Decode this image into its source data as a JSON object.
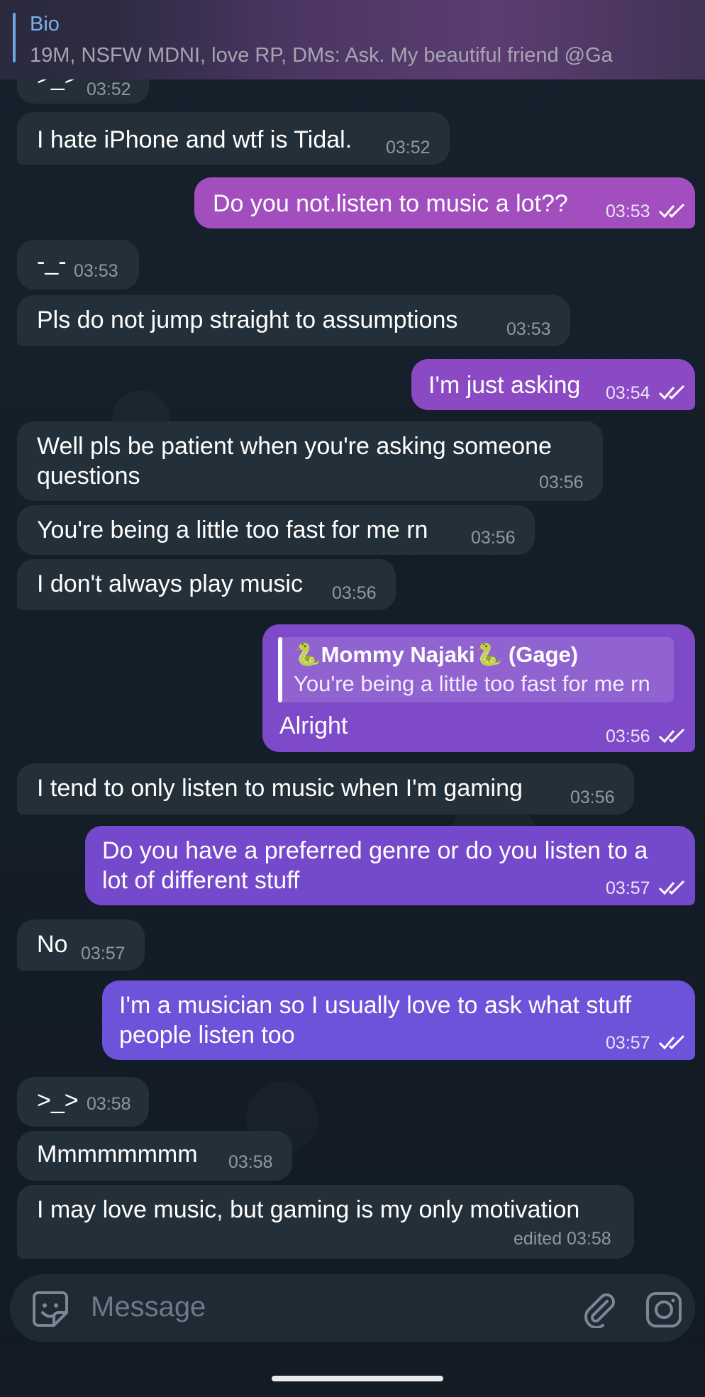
{
  "pinned": {
    "title": "Bio",
    "text": "19M, NSFW MDNI, love RP, DMs: Ask. My beautiful friend @Ga"
  },
  "messages": [
    {
      "dir": "in",
      "text": ">_>",
      "time": "03:52"
    },
    {
      "dir": "in",
      "text": "I hate iPhone and wtf is Tidal.",
      "time": "03:52"
    },
    {
      "dir": "out",
      "text": "Do you not.listen to music a lot??",
      "time": "03:53",
      "status": "read"
    },
    {
      "dir": "in",
      "text": "-_-",
      "time": "03:53"
    },
    {
      "dir": "in",
      "text": "Pls do not jump straight to assumptions",
      "time": "03:53"
    },
    {
      "dir": "out",
      "text": "I'm just asking",
      "time": "03:54",
      "status": "read"
    },
    {
      "dir": "in",
      "lines": [
        "Well pls be patient when you're asking someone",
        "questions"
      ],
      "time": "03:56"
    },
    {
      "dir": "in",
      "text": "You're being a little too fast for me rn",
      "time": "03:56"
    },
    {
      "dir": "in",
      "text": "I don't always play music",
      "time": "03:56"
    },
    {
      "dir": "out",
      "reply": {
        "name": "🐍Mommy Najaki🐍 (Gage)",
        "text": "You're being a little too fast for me rn"
      },
      "text": "Alright",
      "time": "03:56",
      "status": "read"
    },
    {
      "dir": "in",
      "text": "I tend to only listen to music when I'm gaming",
      "time": "03:56"
    },
    {
      "dir": "out",
      "lines": [
        "Do you have a preferred genre or do you listen to a",
        "lot of different stuff"
      ],
      "time": "03:57",
      "status": "read"
    },
    {
      "dir": "in",
      "text": "No",
      "time": "03:57"
    },
    {
      "dir": "out",
      "lines": [
        "I'm a musician so I usually love to ask what stuff",
        "people listen too"
      ],
      "time": "03:57",
      "status": "read"
    },
    {
      "dir": "in",
      "text": ">_>",
      "time": "03:58"
    },
    {
      "dir": "in",
      "text": "Mmmmmmmm",
      "time": "03:58"
    },
    {
      "dir": "in",
      "text": "I may love music, but gaming is my only motivation",
      "time": "edited 03:58"
    }
  ],
  "composer": {
    "placeholder": "Message",
    "left_icon": "sticker-icon",
    "attach_icon": "paperclip-icon",
    "camera_icon": "instagram-camera-icon"
  },
  "colors": {
    "incoming": "#243039",
    "outgoing_top": "#a94fbf",
    "outgoing_mid": "#7c48c8",
    "outgoing_bottom": "#6a52d8",
    "background": "#16202b"
  }
}
